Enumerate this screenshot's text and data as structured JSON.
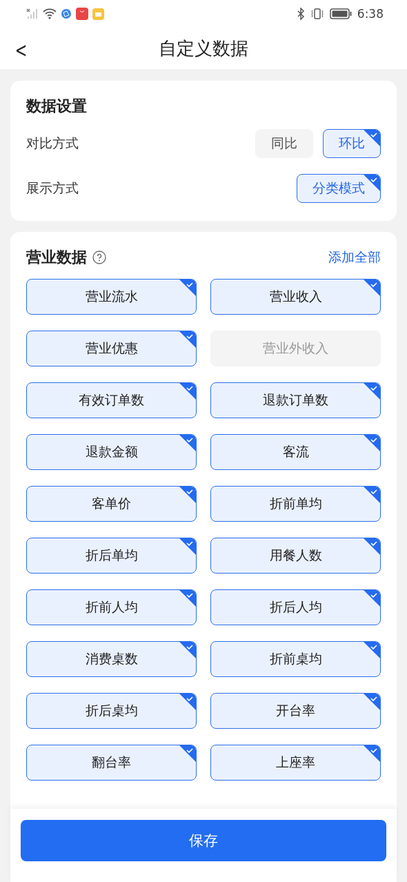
{
  "status_bar": {
    "time": "6:38"
  },
  "header": {
    "back": "<",
    "title": "自定义数据"
  },
  "settings": {
    "title": "数据设置",
    "rows": [
      {
        "label": "对比方式",
        "options": [
          {
            "label": "同比",
            "selected": false
          },
          {
            "label": "环比",
            "selected": true
          }
        ]
      },
      {
        "label": "展示方式",
        "options": [
          {
            "label": "分类模式",
            "selected": true
          }
        ]
      }
    ]
  },
  "business": {
    "title": "营业数据",
    "add_all": "添加全部",
    "items": [
      {
        "label": "营业流水",
        "selected": true
      },
      {
        "label": "营业收入",
        "selected": true
      },
      {
        "label": "营业优惠",
        "selected": true
      },
      {
        "label": "营业外收入",
        "selected": false
      },
      {
        "label": "有效订单数",
        "selected": true
      },
      {
        "label": "退款订单数",
        "selected": true
      },
      {
        "label": "退款金额",
        "selected": true
      },
      {
        "label": "客流",
        "selected": true
      },
      {
        "label": "客单价",
        "selected": true
      },
      {
        "label": "折前单均",
        "selected": true
      },
      {
        "label": "折后单均",
        "selected": true
      },
      {
        "label": "用餐人数",
        "selected": true
      },
      {
        "label": "折前人均",
        "selected": true
      },
      {
        "label": "折后人均",
        "selected": true
      },
      {
        "label": "消费桌数",
        "selected": true
      },
      {
        "label": "折前桌均",
        "selected": true
      },
      {
        "label": "折后桌均",
        "selected": true
      },
      {
        "label": "开台率",
        "selected": true
      },
      {
        "label": "翻台率",
        "selected": true
      },
      {
        "label": "上座率",
        "selected": true
      }
    ]
  },
  "footer": {
    "save": "保存"
  }
}
